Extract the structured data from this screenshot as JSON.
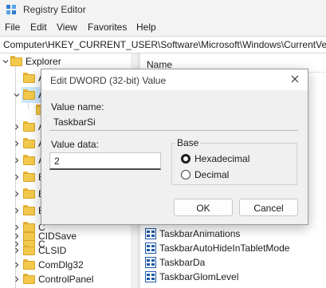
{
  "window": {
    "title": "Registry Editor"
  },
  "menu": {
    "items": [
      "File",
      "Edit",
      "View",
      "Favorites",
      "Help"
    ]
  },
  "address": {
    "path": "Computer\\HKEY_CURRENT_USER\\Software\\Microsoft\\Windows\\CurrentVersion\\Explorer\\Advanced"
  },
  "tree": {
    "items": [
      {
        "label": "Explorer",
        "state": "expanded"
      },
      {
        "label": "A",
        "state": "collapsed"
      },
      {
        "label": "A",
        "state": "expanded"
      },
      {
        "label": "",
        "state": "leaf"
      },
      {
        "label": "A",
        "state": "collapsed"
      },
      {
        "label": "A",
        "state": "collapsed"
      },
      {
        "label": "A",
        "state": "collapsed"
      },
      {
        "label": "B",
        "state": "collapsed"
      },
      {
        "label": "B",
        "state": "collapsed"
      },
      {
        "label": "B",
        "state": "collapsed"
      },
      {
        "label": "C",
        "state": "collapsed"
      },
      {
        "label": "C",
        "state": "collapsed"
      },
      {
        "label": "CIDSave",
        "state": "collapsed"
      },
      {
        "label": "CLSID",
        "state": "collapsed"
      },
      {
        "label": "ComDlg32",
        "state": "collapsed"
      },
      {
        "label": "ControlPanel",
        "state": "collapsed"
      }
    ]
  },
  "right_pane": {
    "column_name": "Name",
    "values": [
      "TaskbarAnimations",
      "TaskbarAutoHideInTabletMode",
      "TaskbarDa",
      "TaskbarGlomLevel"
    ]
  },
  "dialog": {
    "title": "Edit DWORD (32-bit) Value",
    "value_name_label": "Value name:",
    "value_name": "TaskbarSi",
    "value_data_label": "Value data:",
    "value_data": "2",
    "base_label": "Base",
    "base_options": [
      {
        "label": "Hexadecimal",
        "selected": true
      },
      {
        "label": "Decimal",
        "selected": false
      }
    ],
    "ok_label": "OK",
    "cancel_label": "Cancel"
  },
  "colors": {
    "folder": "#f2c94c",
    "selection": "#cce8ff",
    "reg_icon": "#1e5aa8"
  }
}
